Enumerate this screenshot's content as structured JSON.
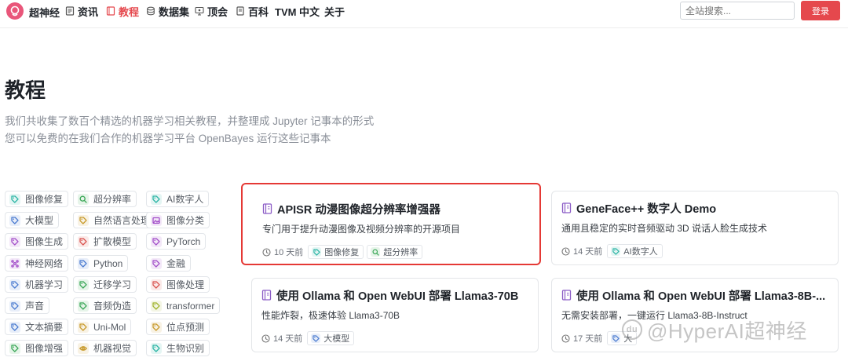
{
  "nav": {
    "brand": "超神经",
    "items": [
      {
        "label": "资讯",
        "icon": "document-icon",
        "active": false
      },
      {
        "label": "教程",
        "icon": "notebook-icon",
        "active": true
      },
      {
        "label": "数据集",
        "icon": "database-icon",
        "active": false
      },
      {
        "label": "顶会",
        "icon": "presentation-icon",
        "active": false
      },
      {
        "label": "百科",
        "icon": "book-icon",
        "active": false
      },
      {
        "label": "TVM 中文",
        "icon": "",
        "active": false
      },
      {
        "label": "关于",
        "icon": "",
        "active": false
      }
    ],
    "search_placeholder": "全站搜索...",
    "login_label": "登录"
  },
  "hero": {
    "title": "教程",
    "desc_line1": "我们共收集了数百个精选的机器学习相关教程，并整理成 Jupyter 记事本的形式",
    "desc_line2": "您可以免费的在我们合作的机器学习平台 OpenBayes 运行这些记事本"
  },
  "tags": [
    {
      "label": "图像修复",
      "icon": "tag-icon",
      "color": "#2bb5a5"
    },
    {
      "label": "超分辨率",
      "icon": "zoom-icon",
      "color": "#3aa757"
    },
    {
      "label": "AI数字人",
      "icon": "tag-icon",
      "color": "#2bb5a5"
    },
    {
      "label": "大模型",
      "icon": "tag-icon",
      "color": "#4a7bd0"
    },
    {
      "label": "自然语言处理",
      "icon": "tag-icon",
      "color": "#c89a2b"
    },
    {
      "label": "图像分类",
      "icon": "image-icon",
      "color": "#a34fc9"
    },
    {
      "label": "图像生成",
      "icon": "tag-icon",
      "color": "#a34fc9"
    },
    {
      "label": "扩散模型",
      "icon": "tag-icon",
      "color": "#d9534f"
    },
    {
      "label": "PyTorch",
      "icon": "tag-icon",
      "color": "#a34fc9"
    },
    {
      "label": "神经网络",
      "icon": "network-icon",
      "color": "#a34fc9"
    },
    {
      "label": "Python",
      "icon": "tag-icon",
      "color": "#4a7bd0"
    },
    {
      "label": "金融",
      "icon": "tag-icon",
      "color": "#a34fc9"
    },
    {
      "label": "机器学习",
      "icon": "tag-icon",
      "color": "#4a7bd0"
    },
    {
      "label": "迁移学习",
      "icon": "tag-icon",
      "color": "#3aa757"
    },
    {
      "label": "图像处理",
      "icon": "tag-icon",
      "color": "#d9534f"
    },
    {
      "label": "声音",
      "icon": "tag-icon",
      "color": "#4a7bd0"
    },
    {
      "label": "音频伪造",
      "icon": "tag-icon",
      "color": "#3aa757"
    },
    {
      "label": "transformer",
      "icon": "tag-icon",
      "color": "#a0b32b"
    },
    {
      "label": "文本摘要",
      "icon": "tag-icon",
      "color": "#4a7bd0"
    },
    {
      "label": "Uni-Mol",
      "icon": "tag-icon",
      "color": "#c89a2b"
    },
    {
      "label": "位点预测",
      "icon": "tag-icon",
      "color": "#c89a2b"
    },
    {
      "label": "图像增强",
      "icon": "tag-icon",
      "color": "#3aa757"
    },
    {
      "label": "机器视觉",
      "icon": "eye-icon",
      "color": "#c89a2b"
    },
    {
      "label": "生物识别",
      "icon": "tag-icon",
      "color": "#2bb5a5"
    }
  ],
  "cards": [
    {
      "title": "APISR 动漫图像超分辨率增强器",
      "desc": "专门用于提升动漫图像及视频分辨率的开源项目",
      "time": "10 天前",
      "tags": [
        {
          "label": "图像修复",
          "icon": "tag-icon",
          "color": "#2bb5a5"
        },
        {
          "label": "超分辨率",
          "icon": "zoom-icon",
          "color": "#3aa757"
        }
      ],
      "highlight": true
    },
    {
      "title": "GeneFace++ 数字人 Demo",
      "desc": "通用且稳定的实时音频驱动 3D 说话人脸生成技术",
      "time": "14 天前",
      "tags": [
        {
          "label": "AI数字人",
          "icon": "tag-icon",
          "color": "#2bb5a5"
        }
      ],
      "highlight": false
    },
    {
      "title": "使用 Ollama 和 Open WebUI 部署 Llama3-70B",
      "desc": "性能炸裂，极速体验 Llama3-70B",
      "time": "14 天前",
      "tags": [
        {
          "label": "大模型",
          "icon": "tag-icon",
          "color": "#4a7bd0"
        }
      ],
      "highlight": false
    },
    {
      "title": "使用 Ollama 和 Open WebUI 部署 Llama3-8B-...",
      "desc": "无需安装部署，一键运行 Llama3-8B-Instruct",
      "time": "17 天前",
      "tags": [
        {
          "label": "大",
          "icon": "tag-icon",
          "color": "#4a7bd0"
        }
      ],
      "highlight": false
    }
  ],
  "watermark": {
    "badge": "du",
    "text": "@HyperAI超神经"
  }
}
